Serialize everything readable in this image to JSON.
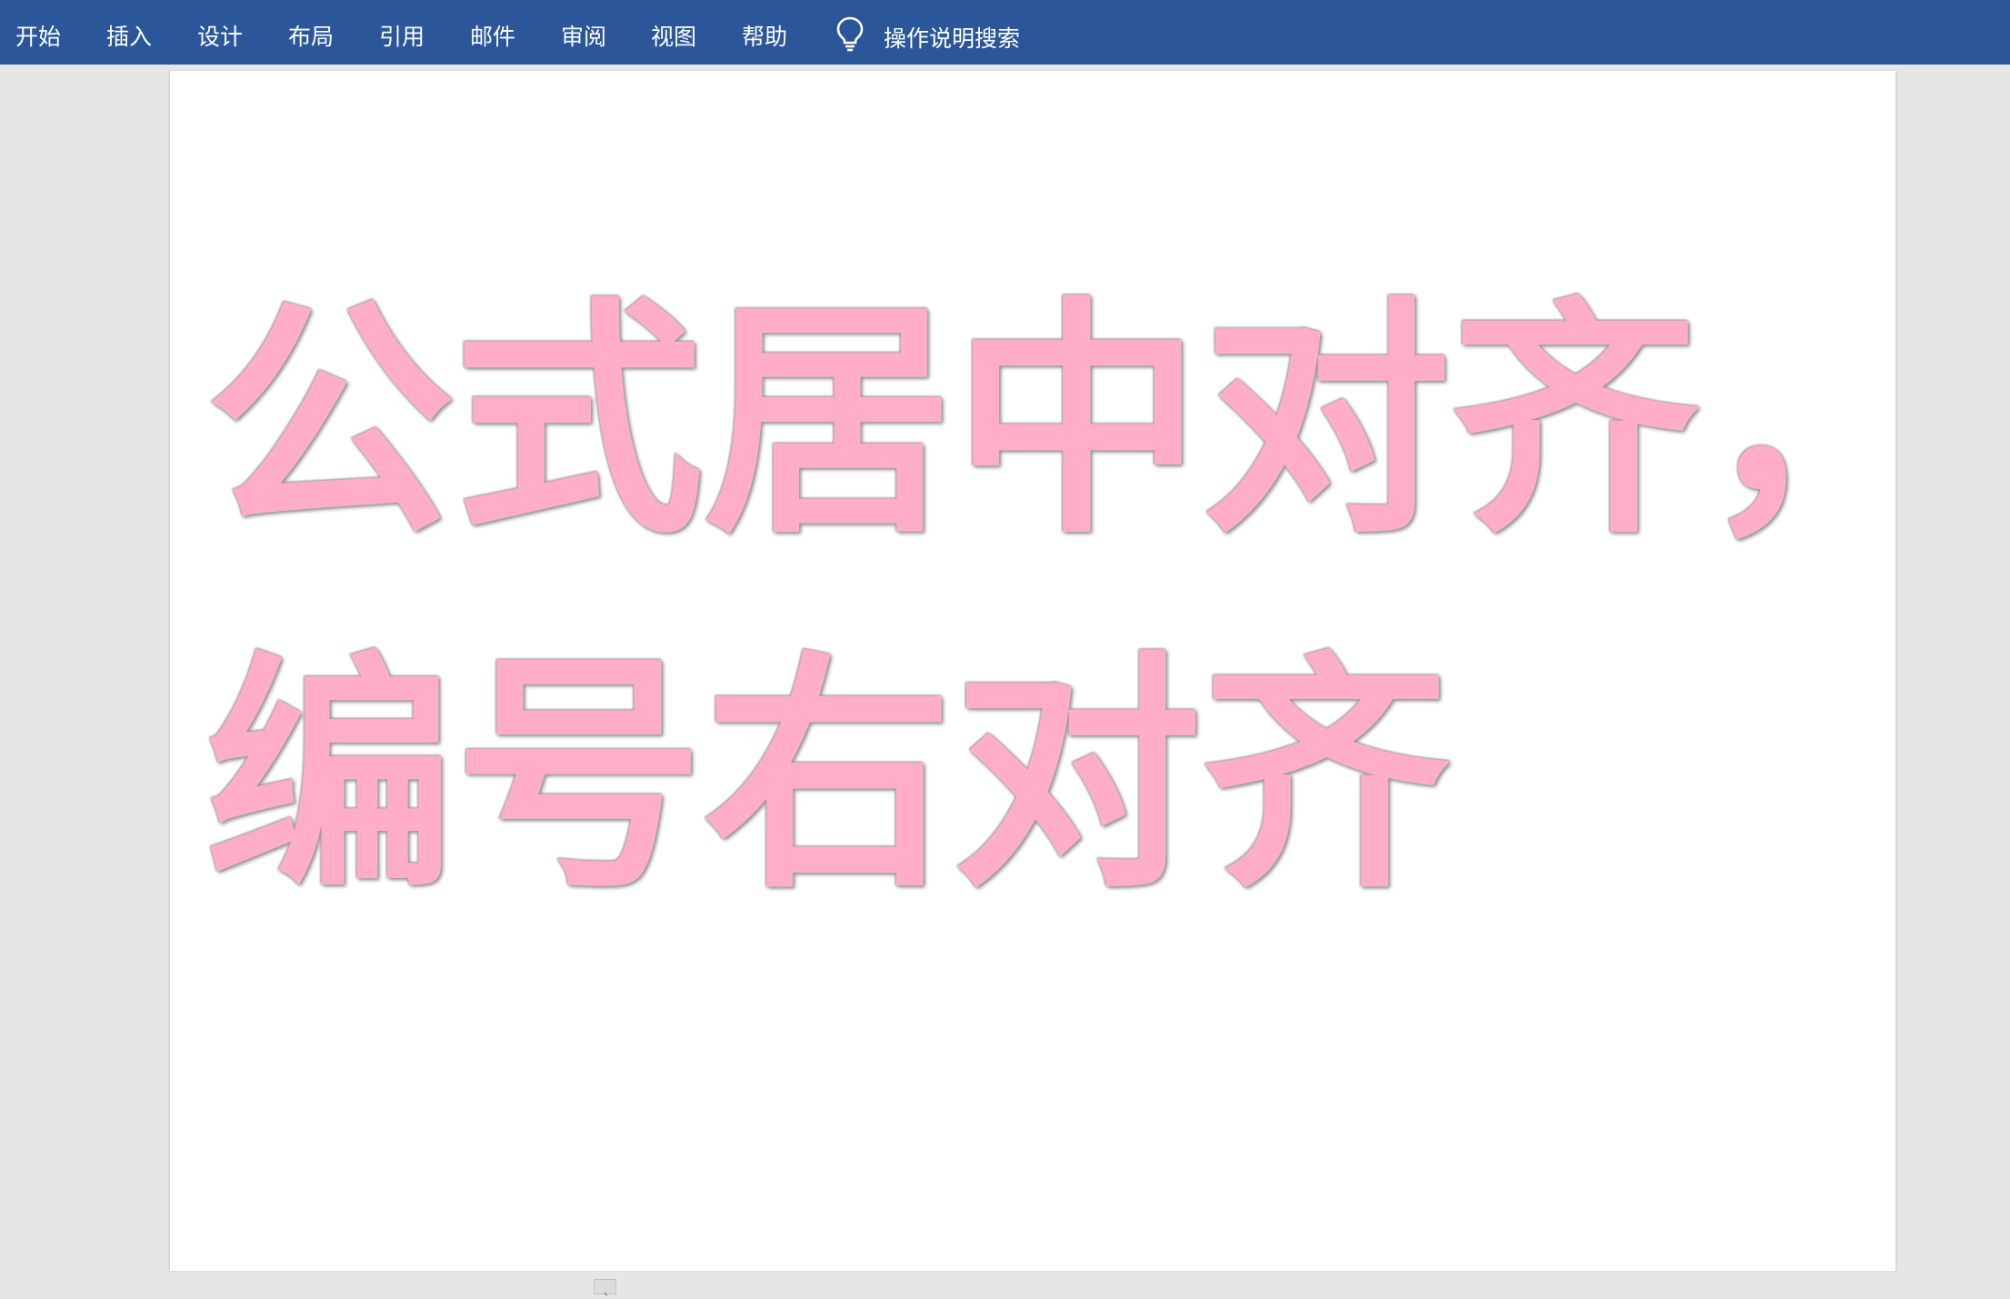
{
  "ribbon": {
    "tabs": [
      {
        "label": "开始"
      },
      {
        "label": "插入"
      },
      {
        "label": "设计"
      },
      {
        "label": "布局"
      },
      {
        "label": "引用"
      },
      {
        "label": "邮件"
      },
      {
        "label": "审阅"
      },
      {
        "label": "视图"
      },
      {
        "label": "帮助"
      }
    ],
    "tell_me": {
      "icon": "lightbulb-icon",
      "label": "操作说明搜索"
    },
    "background_color": "#2b579a"
  },
  "document": {
    "line1": "公式居中对齐，",
    "line2": "编号右对齐",
    "text_color": "#ffadc9"
  }
}
